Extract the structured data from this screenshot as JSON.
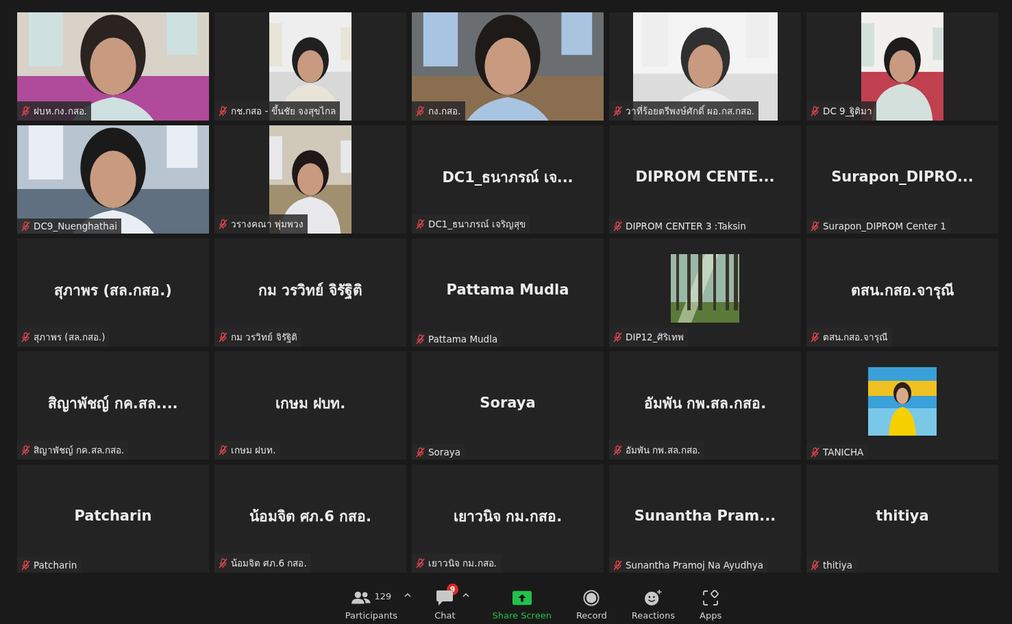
{
  "tiles": [
    {
      "kind": "video",
      "name": "ฝบห.กง.กสอ.",
      "muted": true
    },
    {
      "kind": "portrait",
      "name": "กช.กสอ - ขึ้นชัย จงสุขไกล",
      "muted": true
    },
    {
      "kind": "video",
      "name": "กง.กสอ.",
      "muted": true
    },
    {
      "kind": "square",
      "name": "วาที่ร้อยตรีพงษ์ศักดิ์ ผอ.กส.กสอ.",
      "muted": true
    },
    {
      "kind": "portrait",
      "name": "DC 9_ฐิติมา",
      "muted": true
    },
    {
      "kind": "video",
      "name": "DC9_Nuenghathai",
      "muted": true
    },
    {
      "kind": "portrait",
      "name": "วรางคณา พุ่มพวง",
      "muted": true
    },
    {
      "kind": "name",
      "display_name": "DC1_ธนาภรณ์ เจ...",
      "name": "DC1_ธนาภรณ์ เจริญสุข",
      "muted": true
    },
    {
      "kind": "name",
      "display_name": "DIPROM CENTE...",
      "name": "DIPROM CENTER 3 :Taksin",
      "muted": true
    },
    {
      "kind": "name",
      "display_name": "Surapon_DIPRO...",
      "name": "Surapon_DIPROM Center 1",
      "muted": true
    },
    {
      "kind": "name",
      "display_name": "สุภาพร (สล.กสอ.)",
      "name": "สุภาพร (สล.กสอ.)",
      "muted": true
    },
    {
      "kind": "name",
      "display_name": "กม วรวิทย์ จิรัฐิติ",
      "name": "กม วรวิทย์ จิรัฐิติ",
      "muted": true
    },
    {
      "kind": "name",
      "display_name": "Pattama Mudla",
      "name": "Pattama Mudla",
      "muted": true
    },
    {
      "name": "DIP12_ศิริเทพ",
      "muted": true
    },
    {
      "kind": "name",
      "display_name": "ตสน.กสอ.จารุณี",
      "name": "ตสน.กสอ.จารุณี",
      "muted": true
    },
    {
      "kind": "name",
      "display_name": "สิญาพัชญ์ กค.สล....",
      "name": "สิญาพัชญ์ กค.สล.กสอ.",
      "muted": true
    },
    {
      "kind": "name",
      "display_name": "เกษม ฝบท.",
      "name": "เกษม ฝบท.",
      "muted": true
    },
    {
      "kind": "name",
      "display_name": "Soraya",
      "name": "Soraya",
      "muted": true
    },
    {
      "kind": "name",
      "display_name": "อัมพัน กพ.สล.กสอ.",
      "name": "อัมพัน กพ.สล.กสอ.",
      "muted": true
    },
    {
      "name": "TANICHA",
      "muted": true
    },
    {
      "kind": "name",
      "display_name": "Patcharin",
      "name": "Patcharin",
      "muted": true
    },
    {
      "kind": "name",
      "display_name": "น้อมจิต ศภ.6 กสอ.",
      "name": "น้อมจิต ศภ.6 กสอ.",
      "muted": true
    },
    {
      "kind": "name",
      "display_name": "เยาวนิจ กม.กสอ.",
      "name": "เยาวนิจ กม.กสอ.",
      "muted": true
    },
    {
      "kind": "name",
      "display_name": "Sunantha Pram...",
      "name": "Sunantha Pramoj Na Ayudhya",
      "muted": true
    },
    {
      "kind": "name",
      "display_name": "thitiya",
      "name": "thitiya",
      "muted": true
    }
  ],
  "toolbar": [
    {
      "kind": "participants",
      "label": "Participants",
      "count": "129",
      "caret": true
    },
    {
      "kind": "chat",
      "label": "Chat",
      "badge": "9",
      "caret": true
    },
    {
      "kind": "share",
      "label": "Share Screen"
    },
    {
      "kind": "record",
      "label": "Record"
    },
    {
      "kind": "reactions",
      "label": "Reactions"
    },
    {
      "kind": "apps",
      "label": "Apps"
    }
  ]
}
